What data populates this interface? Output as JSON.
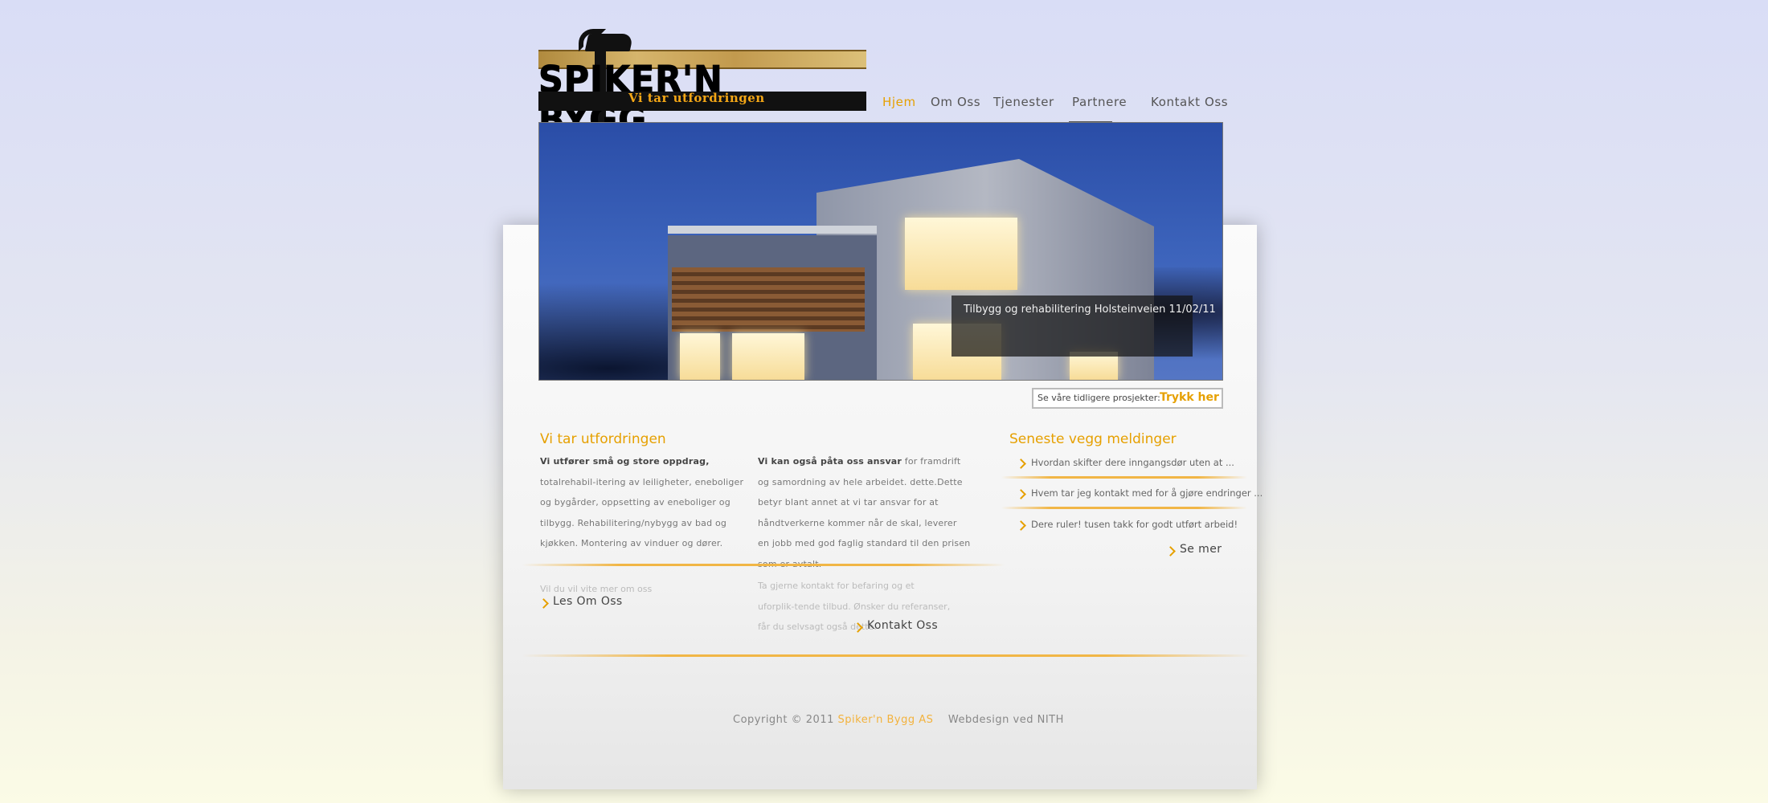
{
  "logo": {
    "wordmark": "SPIKER'N BYGG",
    "tagline": "Vi tar utfordringen"
  },
  "nav": {
    "items": [
      "Hjem",
      "Om Oss",
      "Tjenester",
      "Partnere",
      "Kontakt Oss"
    ],
    "active": "Hjem"
  },
  "hero": {
    "caption": "Tilbygg og rehabilitering Holsteinveien 11/02/11"
  },
  "projects_box": {
    "label": "Se våre tidligere prosjekter:",
    "link": "Trykk her"
  },
  "col1": {
    "heading": "Vi tar utfordringen",
    "lead": "Vi utfører små og store oppdrag,",
    "text": " totalrehabil-itering av leiligheter, eneboliger og bygårder, oppsetting av eneboliger og tilbygg. Rehabilitering/nybygg av bad og kjøkken. Montering av vinduer og dører.",
    "more_hint": "Vil du vil vite mer om oss",
    "more_link": "Les Om Oss"
  },
  "col2": {
    "lead": "Vi kan også påta oss ansvar",
    "text": " for framdrift og samordning av hele arbeidet. dette.Dette betyr blant annet at vi tar ansvar for at håndtverkerne kommer når de skal, leverer en jobb med god faglig standard til den prisen som er avtalt.",
    "contact_text": "Ta gjerne kontakt for befaring og et uforplik-tende tilbud. Ønsker du referanser, får du selvsagt også dette.",
    "contact_link": "Kontakt Oss"
  },
  "sidebar": {
    "heading": "Seneste vegg meldinger",
    "messages": [
      "Hvordan skifter dere inngangsdør uten at ...",
      "Hvem tar jeg kontakt med for å gjøre endringer ...",
      "Dere ruler! tusen takk for godt utført arbeid!"
    ],
    "more_link": "Se mer"
  },
  "footer": {
    "copyright": "Copyright © 2011",
    "brand": "Spiker'n Bygg AS",
    "credit": "Webdesign ved NITH"
  },
  "colors": {
    "accent": "#e6a000",
    "separator": "#f1b646"
  }
}
